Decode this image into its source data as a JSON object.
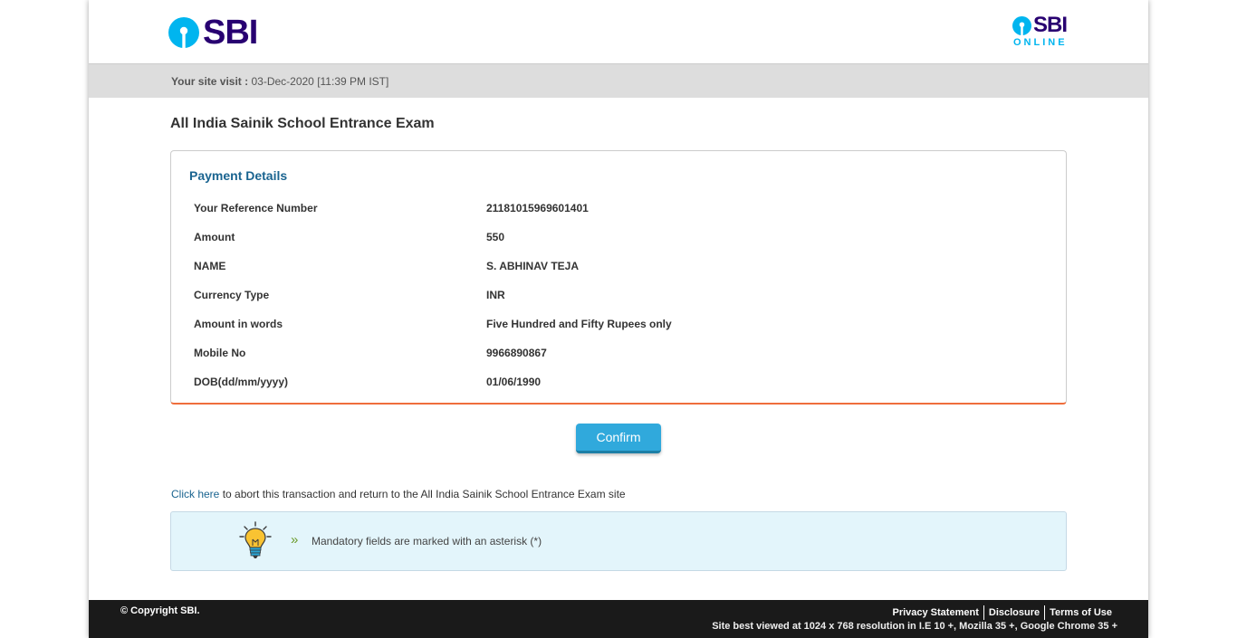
{
  "header": {
    "logo_text": "SBI",
    "right_logo_text": "SBI",
    "right_logo_sub": "ONLINE",
    "brand_colors": {
      "navy": "#280071",
      "cyan": "#00b5ef"
    }
  },
  "visit": {
    "label": "Your site visit :",
    "value": "03-Dec-2020 [11:39 PM IST]"
  },
  "page_title": "All India Sainik School Entrance Exam",
  "payment": {
    "heading": "Payment Details",
    "rows": [
      {
        "label": "Your Reference Number",
        "value": "21181015969601401"
      },
      {
        "label": "Amount",
        "value": "550"
      },
      {
        "label": "NAME",
        "value": "S. ABHINAV TEJA"
      },
      {
        "label": "Currency Type",
        "value": "INR"
      },
      {
        "label": "Amount in words",
        "value": "Five Hundred and Fifty Rupees only"
      },
      {
        "label": "Mobile No",
        "value": "9966890867"
      },
      {
        "label": "DOB(dd/mm/yyyy)",
        "value": "01/06/1990"
      }
    ]
  },
  "confirm_label": "Confirm",
  "abort": {
    "link_text": "Click here",
    "text": " to abort this transaction and return to the All India Sainik School Entrance Exam site"
  },
  "info": {
    "chevron": "»",
    "icon": "lightbulb-icon",
    "text": "Mandatory fields are marked with an asterisk (*)"
  },
  "footer": {
    "copyright": "© Copyright SBI.",
    "links": [
      "Privacy Statement",
      "Disclosure",
      "Terms of Use"
    ],
    "best_viewed": "Site best viewed at 1024 x 768 resolution in I.E 10 +, Mozilla 35 +, Google Chrome 35 +"
  }
}
